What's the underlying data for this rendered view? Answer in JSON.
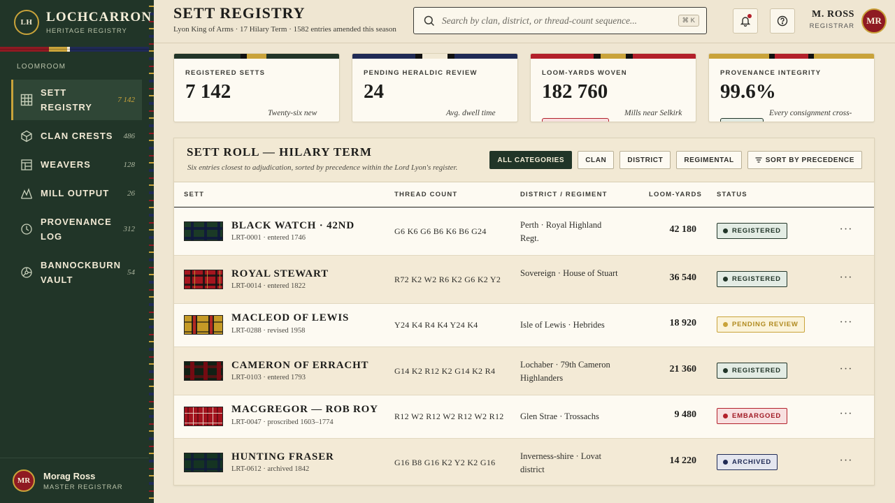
{
  "brand": {
    "seal": "LH",
    "name": "LOCHCARRON",
    "subtitle": "HERITAGE REGISTRY"
  },
  "sidebar": {
    "section_label": "LOOMROOM",
    "items": [
      {
        "label": "SETT REGISTRY",
        "count": "7 142",
        "icon": "grid-icon",
        "active": true
      },
      {
        "label": "CLAN CRESTS",
        "count": "486",
        "icon": "crest-icon"
      },
      {
        "label": "WEAVERS",
        "count": "128",
        "icon": "loom-icon"
      },
      {
        "label": "MILL OUTPUT",
        "count": "26",
        "icon": "mountain-icon"
      },
      {
        "label": "PROVENANCE LOG",
        "count": "312",
        "icon": "clock-icon"
      },
      {
        "label": "BANNOCKBURN VAULT",
        "count": "54",
        "icon": "vault-icon"
      }
    ],
    "user": {
      "initials": "MR",
      "name": "Morag Ross",
      "role": "MASTER REGISTRAR"
    }
  },
  "header": {
    "title": "SETT REGISTRY",
    "subtitle": "Lyon King of Arms · 17 Hilary Term · 1582 entries amended this season",
    "search_placeholder": "Search by clan, district, or thread-count sequence...",
    "search_shortcut": "⌘ K",
    "user": {
      "name": "M. ROSS",
      "role": "REGISTRAR",
      "initials": "MR"
    }
  },
  "kpis": [
    {
      "label": "REGISTERED SETTS",
      "value": "7 142",
      "note": "Twenty-six new"
    },
    {
      "label": "PENDING HERALDIC REVIEW",
      "value": "24",
      "note": "Avg. dwell time"
    },
    {
      "label": "LOOM-YARDS WOVEN",
      "value": "182 760",
      "note": "Mills near Selkirk",
      "pill": ""
    },
    {
      "label": "PROVENANCE INTEGRITY",
      "value": "99.6%",
      "note": "Every consignment cross-",
      "pill": ""
    }
  ],
  "table": {
    "title": "SETT ROLL — HILARY TERM",
    "subtitle": "Six entries closest to adjudication, sorted by precedence within the Lord Lyon's register.",
    "filters": [
      "ALL CATEGORIES",
      "CLAN",
      "DISTRICT",
      "REGIMENTAL"
    ],
    "sort_label": "SORT BY PRECEDENCE",
    "columns": [
      "SETT",
      "THREAD COUNT",
      "DISTRICT / REGIMENT",
      "LOOM-YARDS",
      "STATUS"
    ],
    "rows": [
      {
        "name": "BLACK WATCH · 42ND",
        "meta": "LRT-0001 · entered 1746",
        "thread": "G6 K6 G6 B6 K6 B6 G24",
        "district": "Perth · Royal Highland Regt.",
        "yards": "42 180",
        "status": "REGISTERED",
        "status_kind": "reg"
      },
      {
        "name": "ROYAL STEWART",
        "meta": "LRT-0014 · entered 1822",
        "thread": "R72 K2 W2 R6 K2 G6 K2 Y2",
        "district": "Sovereign · House of Stuart",
        "yards": "36 540",
        "status": "REGISTERED",
        "status_kind": "reg"
      },
      {
        "name": "MACLEOD OF LEWIS",
        "meta": "LRT-0288 · revised 1958",
        "thread": "Y24 K4 R4 K4 Y24 K4",
        "district": "Isle of Lewis · Hebrides",
        "yards": "18 920",
        "status": "PENDING REVIEW",
        "status_kind": "pend"
      },
      {
        "name": "CAMERON OF ERRACHT",
        "meta": "LRT-0103 · entered 1793",
        "thread": "G14 K2 R12 K2 G14 K2 R4",
        "district": "Lochaber · 79th Cameron Highlanders",
        "yards": "21 360",
        "status": "REGISTERED",
        "status_kind": "reg"
      },
      {
        "name": "MACGREGOR — ROB ROY",
        "meta": "LRT-0047 · proscribed 1603–1774",
        "thread": "R12 W2 R12 W2 R12 W2 R12",
        "district": "Glen Strae · Trossachs",
        "yards": "9 480",
        "status": "EMBARGOED",
        "status_kind": "emb"
      },
      {
        "name": "HUNTING FRASER",
        "meta": "LRT-0612 · archived 1842",
        "thread": "G16 B8 G16 K2 Y2 K2 G16",
        "district": "Inverness-shire · Lovat district",
        "yards": "14 220",
        "status": "ARCHIVED",
        "status_kind": "arch"
      }
    ]
  },
  "colors": {
    "forest": "#213528",
    "gold": "#c9a33a",
    "crimson": "#8f1a22",
    "navy": "#1f2a55",
    "parchment": "#efe6d2"
  }
}
